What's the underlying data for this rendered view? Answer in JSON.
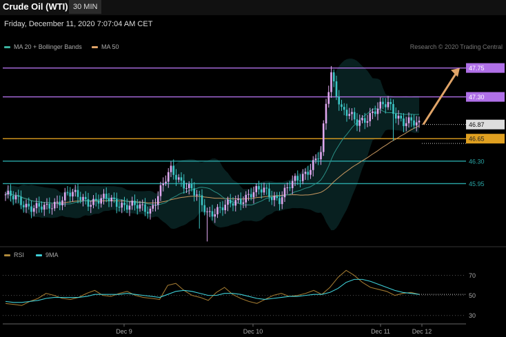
{
  "header": {
    "title": "Crude Oil (WTI)",
    "interval": "30 MIN"
  },
  "timestamp": "Friday, December 11, 2020 7:07:04 AM CET",
  "legend": {
    "main": [
      {
        "label": "MA 20 + Bollinger Bands",
        "color": "#3bb3a0"
      },
      {
        "label": "MA 50",
        "color": "#e0a468"
      }
    ],
    "rsi": [
      {
        "label": "RSI",
        "color": "#b08a3c"
      },
      {
        "label": "9MA",
        "color": "#3fd0d8"
      }
    ]
  },
  "credit": "Research © 2020 Trading Central",
  "chart_data": [
    {
      "type": "candlestick",
      "title": "Crude Oil (WTI)",
      "x_ticks": [
        "Dec 9",
        "Dec 10",
        "Dec 11",
        "Dec 12"
      ],
      "ylim": [
        45.0,
        47.95
      ],
      "levels": [
        {
          "value": 47.75,
          "label": "47.75",
          "color": "#b070e8"
        },
        {
          "value": 47.3,
          "label": "47.30",
          "color": "#b070e8"
        },
        {
          "value": 46.65,
          "label": "46.65",
          "color": "#e0a020"
        },
        {
          "value": 46.3,
          "label": "46.30",
          "color": "#2aa8a8"
        },
        {
          "value": 45.95,
          "label": "45.95",
          "color": "#2aa8a8"
        }
      ],
      "last_price": {
        "value": 46.87,
        "label": "46.87"
      },
      "forecast_arrow": {
        "from": 46.87,
        "to": 47.75
      },
      "anchors": [
        {
          "i": 0,
          "c": 45.78
        },
        {
          "i": 8,
          "c": 45.62
        },
        {
          "i": 16,
          "c": 45.55
        },
        {
          "i": 24,
          "c": 45.8
        },
        {
          "i": 32,
          "c": 45.68
        },
        {
          "i": 40,
          "c": 45.7
        },
        {
          "i": 48,
          "c": 45.6
        },
        {
          "i": 56,
          "c": 45.55
        },
        {
          "i": 64,
          "c": 46.15
        },
        {
          "i": 72,
          "c": 45.85
        },
        {
          "i": 78,
          "c": 45.5
        },
        {
          "i": 86,
          "c": 45.6
        },
        {
          "i": 94,
          "c": 45.78
        },
        {
          "i": 100,
          "c": 45.85
        },
        {
          "i": 106,
          "c": 45.7
        },
        {
          "i": 112,
          "c": 46.0
        },
        {
          "i": 118,
          "c": 46.2
        },
        {
          "i": 122,
          "c": 46.4
        },
        {
          "i": 124,
          "c": 47.2
        },
        {
          "i": 126,
          "c": 47.68
        },
        {
          "i": 130,
          "c": 47.1
        },
        {
          "i": 136,
          "c": 46.9
        },
        {
          "i": 142,
          "c": 47.05
        },
        {
          "i": 148,
          "c": 47.2
        },
        {
          "i": 154,
          "c": 46.9
        },
        {
          "i": 160,
          "c": 46.87
        }
      ],
      "ma_legend": [
        "MA 20 + Bollinger Bands",
        "MA 50"
      ]
    },
    {
      "type": "line",
      "title": "RSI",
      "series": [
        {
          "name": "RSI",
          "values": [
            42,
            41,
            40,
            44,
            47,
            52,
            50,
            47,
            46,
            48,
            52,
            55,
            50,
            49,
            52,
            54,
            50,
            48,
            47,
            46,
            60,
            62,
            55,
            50,
            48,
            45,
            53,
            58,
            51,
            47,
            44,
            42,
            46,
            50,
            52,
            49,
            50,
            52,
            55,
            51,
            58,
            68,
            75,
            70,
            63,
            58,
            56,
            54,
            50,
            52,
            53,
            51
          ]
        },
        {
          "name": "9MA",
          "values": [
            44,
            43,
            43,
            44,
            45,
            47,
            48,
            48,
            48,
            48,
            49,
            51,
            51,
            51,
            51,
            52,
            51,
            50,
            49,
            48,
            51,
            54,
            55,
            54,
            52,
            50,
            50,
            52,
            52,
            51,
            49,
            47,
            46,
            47,
            48,
            49,
            49,
            50,
            51,
            51,
            53,
            57,
            63,
            66,
            66,
            64,
            61,
            58,
            55,
            53,
            52,
            51
          ]
        }
      ],
      "ylim": [
        25,
        80
      ],
      "y_ticks": [
        30,
        50,
        70
      ],
      "y_tick_labels": [
        "30",
        "50",
        "70"
      ]
    }
  ]
}
